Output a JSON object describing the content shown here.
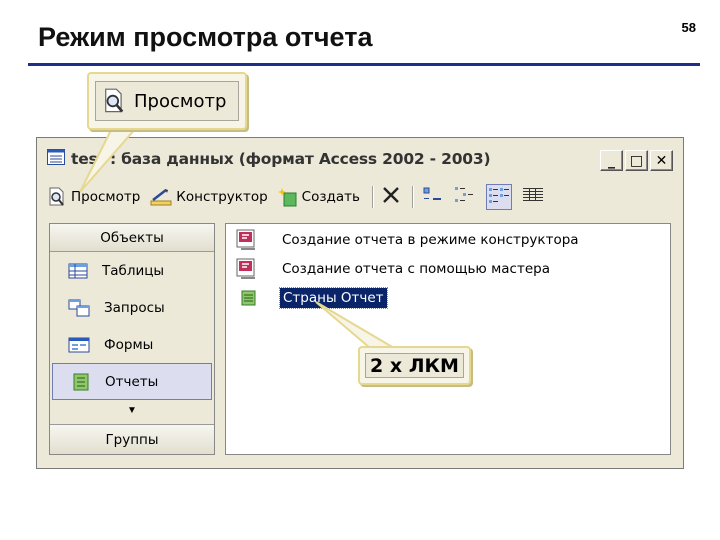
{
  "slide": {
    "title": "Режим просмотра отчета",
    "page_number": "58"
  },
  "callout_view": {
    "label": "Просмотр"
  },
  "callout_dblclick": {
    "label": "2 х ЛКМ"
  },
  "window": {
    "title": "test : база данных (формат Access 2002 - 2003)",
    "buttons": {
      "minimize": "_",
      "maximize": "□",
      "close": "✕"
    }
  },
  "toolbar": {
    "view_label": "Просмотр",
    "design_label": "Конструктор",
    "create_label": "Создать"
  },
  "nav": {
    "header": "Объекты",
    "items": [
      {
        "label": "Таблицы",
        "icon": "table-icon"
      },
      {
        "label": "Запросы",
        "icon": "query-icon"
      },
      {
        "label": "Формы",
        "icon": "form-icon"
      },
      {
        "label": "Отчеты",
        "icon": "report-icon"
      }
    ],
    "active_index": 3,
    "footer": "Группы"
  },
  "objects": [
    {
      "label": "Создание отчета в режиме конструктора",
      "icon": "wizard-icon"
    },
    {
      "label": "Создание отчета с помощью мастера",
      "icon": "wizard-icon"
    },
    {
      "label": "Страны Отчет",
      "icon": "report-icon",
      "selected": true
    }
  ],
  "colors": {
    "title_rule": "#1f2e8a",
    "selection": "#0a246a",
    "callout_fill": "#f7f4e8",
    "callout_border": "#e6d890"
  }
}
